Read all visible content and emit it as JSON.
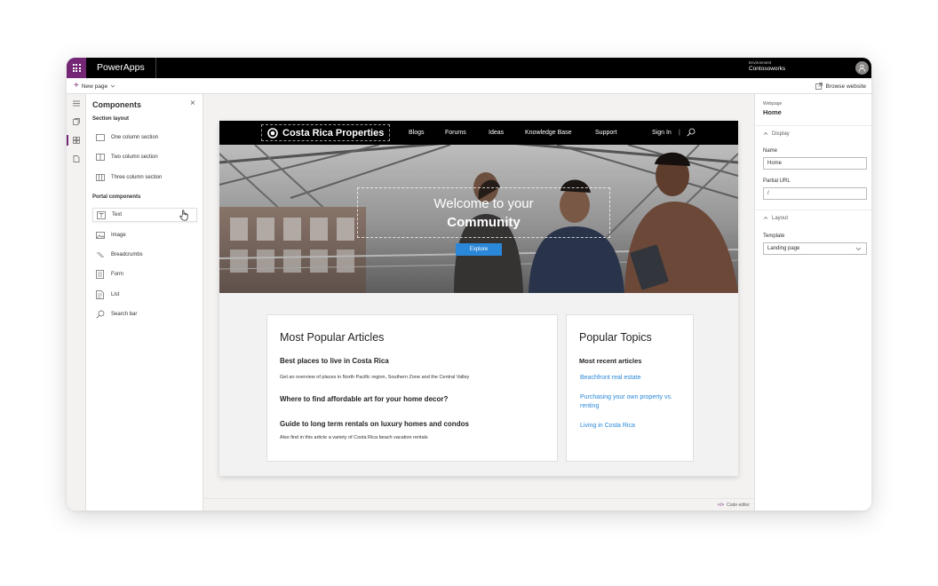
{
  "app": {
    "name": "PowerApps",
    "environment_label": "Environment",
    "environment_name": "Contosoworks"
  },
  "toolbar": {
    "new_page_label": "New page",
    "browse_website_label": "Browse website"
  },
  "components_panel": {
    "title": "Components",
    "section_layout_label": "Section layout",
    "layout_items": [
      {
        "label": "One column section",
        "icon": "one-column-icon"
      },
      {
        "label": "Two column section",
        "icon": "two-column-icon"
      },
      {
        "label": "Three column section",
        "icon": "three-column-icon"
      }
    ],
    "portal_components_label": "Portal components",
    "portal_items": [
      {
        "label": "Text",
        "icon": "text-icon"
      },
      {
        "label": "Image",
        "icon": "image-icon"
      },
      {
        "label": "Breadcrumbs",
        "icon": "breadcrumbs-icon"
      },
      {
        "label": "Form",
        "icon": "form-icon"
      },
      {
        "label": "List",
        "icon": "list-icon"
      },
      {
        "label": "Search bar",
        "icon": "search-icon"
      }
    ]
  },
  "site": {
    "brand": "Costa Rica Properties",
    "nav": [
      "Blogs",
      "Forums",
      "Ideas",
      "Knowledge Base",
      "Support"
    ],
    "sign_in": "Sign In",
    "hero_line1": "Welcome to your",
    "hero_line2": "Community",
    "explore_label": "Explore",
    "articles": {
      "heading": "Most Popular Articles",
      "items": [
        {
          "title": "Best places to live in Costa Rica",
          "desc": "Get an overview of places in North Pacific region, Southern Zone and the Central Valley"
        },
        {
          "title": "Where to find affordable art for your home decor?",
          "desc": ""
        },
        {
          "title": "Guide to long term rentals on luxury homes and condos",
          "desc": "Also find in this article  a variety of Costa Rica beach vacation rentals"
        }
      ]
    },
    "topics": {
      "heading": "Popular Topics",
      "subheading": "Most recent articles",
      "links": [
        "Beachfront real estate",
        "Purchasing your own property vs. renting",
        "Living in Costa Rica"
      ]
    }
  },
  "code_editor_label": "Code editor",
  "properties": {
    "webpage_label": "Webpage",
    "webpage_value": "Home",
    "display_section": "Display",
    "name_label": "Name",
    "name_value": "Home",
    "partial_url_label": "Partial URL",
    "partial_url_value": "/",
    "layout_section": "Layout",
    "template_label": "Template",
    "template_value": "Landing page"
  },
  "colors": {
    "accent": "#742774",
    "link": "#2b88d8",
    "button": "#2b88d8"
  }
}
